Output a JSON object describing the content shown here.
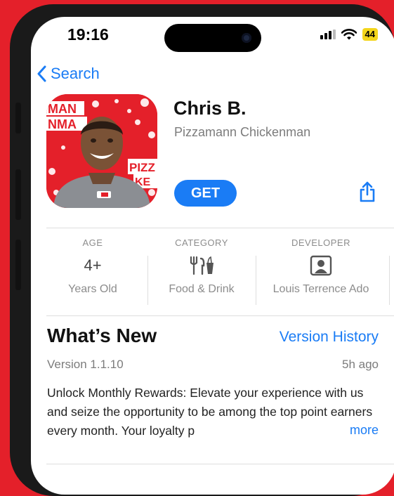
{
  "status_bar": {
    "time": "19:16",
    "battery": "44"
  },
  "nav": {
    "back_label": "Search"
  },
  "app": {
    "name": "Chris B.",
    "subtitle": "Pizzamann Chickenman",
    "get_label": "GET",
    "icon_text": [
      "MAN",
      "NMA",
      "PIZZ",
      "KE"
    ]
  },
  "info": [
    {
      "label": "AGE",
      "value": "4+",
      "sub": "Years Old"
    },
    {
      "label": "CATEGORY",
      "value": "",
      "icon": "utensils-icon",
      "sub": "Food & Drink"
    },
    {
      "label": "DEVELOPER",
      "value": "",
      "icon": "developer-icon",
      "sub": "Louis Terrence Ado"
    }
  ],
  "whats_new": {
    "title": "What’s New",
    "history_link": "Version History",
    "version": "Version 1.1.10",
    "time_ago": "5h ago",
    "description": "Unlock Monthly Rewards: Elevate your experience with us and seize the opportunity to be among the top point earners every month. Your loyalty p",
    "more_label": "more"
  },
  "colors": {
    "accent": "#1a7cf5",
    "background": "#e4202a",
    "battery": "#f3d51b"
  }
}
